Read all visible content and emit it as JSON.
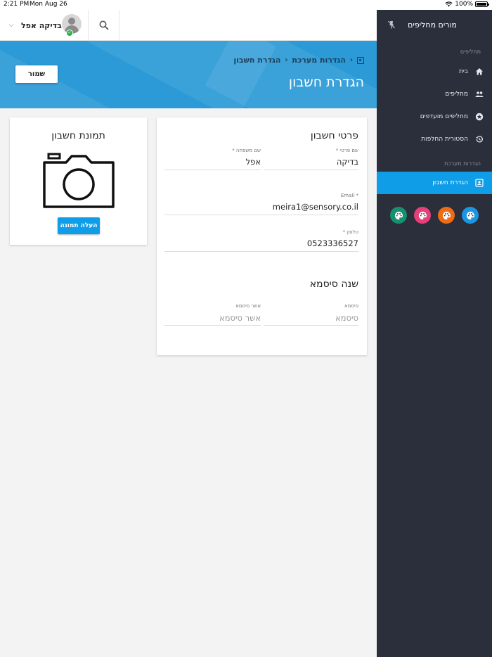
{
  "status_bar": {
    "time": "2:21 PM",
    "date": "Mon Aug 26",
    "battery": "100%",
    "battery_level": 1.0
  },
  "toolbar": {
    "user_name": "בדיקה אפל",
    "user_online": true
  },
  "header": {
    "breadcrumb": [
      "הגדרת חשבון",
      "הגדרות מערכת"
    ],
    "title": "הגדרת חשבון",
    "save_label": "שמור"
  },
  "account_card": {
    "title": "פרטי חשבון",
    "first_name": {
      "label": "שם פרטי *",
      "value": "בדיקה"
    },
    "last_name": {
      "label": "שם משפחה *",
      "value": "אפל"
    },
    "email": {
      "label": "Email *",
      "value": "meira1@sensory.co.il"
    },
    "phone": {
      "label": "טלפון *",
      "value": "0523336527"
    },
    "password_section_title": "שנה סיסמא",
    "password": {
      "label": "סיסמא",
      "placeholder": "סיסמא"
    },
    "confirm_password": {
      "label": "אשר סיסמא",
      "placeholder": "אשר סיסמא"
    }
  },
  "photo_card": {
    "title": "תמונת חשבון",
    "upload_label": "העלה תמונה"
  },
  "sidebar": {
    "brand": "מורים מחליפים",
    "section_main": "מחליפים",
    "items": [
      {
        "label": "בית",
        "icon": "home-icon"
      },
      {
        "label": "מחליפים",
        "icon": "people-icon"
      },
      {
        "label": "מחליפים מועדפים",
        "icon": "star-circle-icon"
      },
      {
        "label": "הסטורית החלפות",
        "icon": "history-icon"
      }
    ],
    "section_settings": "הגדרות מערכת",
    "settings_items": [
      {
        "label": "הגדרת חשבון",
        "icon": "account-box-icon",
        "active": true
      }
    ],
    "theme_colors": [
      "#1a96e2",
      "#ef6c14",
      "#e83e79",
      "#16906e"
    ]
  },
  "colors": {
    "accent": "#0f9de7",
    "banner": "#2b9ad6",
    "sidebar": "#2b2f3b"
  }
}
